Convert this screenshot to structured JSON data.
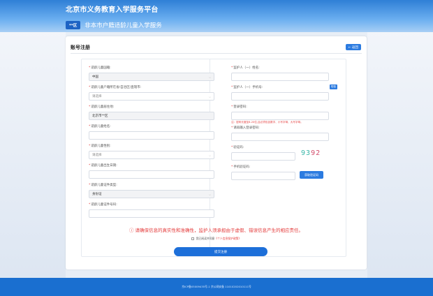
{
  "header": {
    "site_title": "北京市义务教育入学服务平台",
    "area_badge": "**区",
    "sub_title": "非本市户籍适龄儿童入学服务"
  },
  "card": {
    "title": "账号注册",
    "back_label": "← 返回"
  },
  "left_fields": [
    {
      "label": "适龄儿童国籍:",
      "value": "中国",
      "state": "disabled",
      "required": true
    },
    {
      "label": "适龄儿童户籍所在省/自治区/直辖市:",
      "value": "请选择",
      "state": "placeholder",
      "required": true
    },
    {
      "label": "适龄儿童居住地:",
      "value": "北京市**区",
      "state": "disabled",
      "required": true
    },
    {
      "label": "适龄儿童姓名:",
      "value": "",
      "state": "empty",
      "required": true
    },
    {
      "label": "适龄儿童性别:",
      "value": "请选择",
      "state": "placeholder",
      "required": true
    },
    {
      "label": "适龄儿童出生日期:",
      "value": "",
      "state": "empty",
      "required": true
    },
    {
      "label": "适龄儿童证件类型:",
      "value": "身份证",
      "state": "disabled",
      "required": true
    },
    {
      "label": "适龄儿童证件号码:",
      "value": "",
      "state": "empty",
      "required": true
    }
  ],
  "right_fields": {
    "guardian_name_label": "监护人（一）姓名:",
    "guardian_phone_label": "监护人（一）手机号:",
    "phone_tag": "短信",
    "password_label": "登录密码:",
    "password_hint": "注：密码长度至8-20位,且必须包含数字、小写字母、大写字母。",
    "confirm_label": "请再输入登录密码:",
    "captcha_label": "验证码:",
    "captcha_chars": [
      "9",
      "3",
      "9",
      "2"
    ],
    "sms_label": "手机验证码:",
    "sms_button": "获取验证码"
  },
  "notice": "ⓘ 请确保信息的真实性和准确性，监护人须承担由于虚假、错误信息产生的相应责任。",
  "agreement": {
    "text": "我已阅读并同意",
    "link": "《个人信息保护政策》"
  },
  "submit_label": "提交注册",
  "footer": {
    "text": "京ICP备05009435号-1 京公网安备 11010202010111号"
  },
  "colors": {
    "primary": "#1d6fd9",
    "warning": "#e43a3a",
    "header_top": "#2f7fd6"
  }
}
